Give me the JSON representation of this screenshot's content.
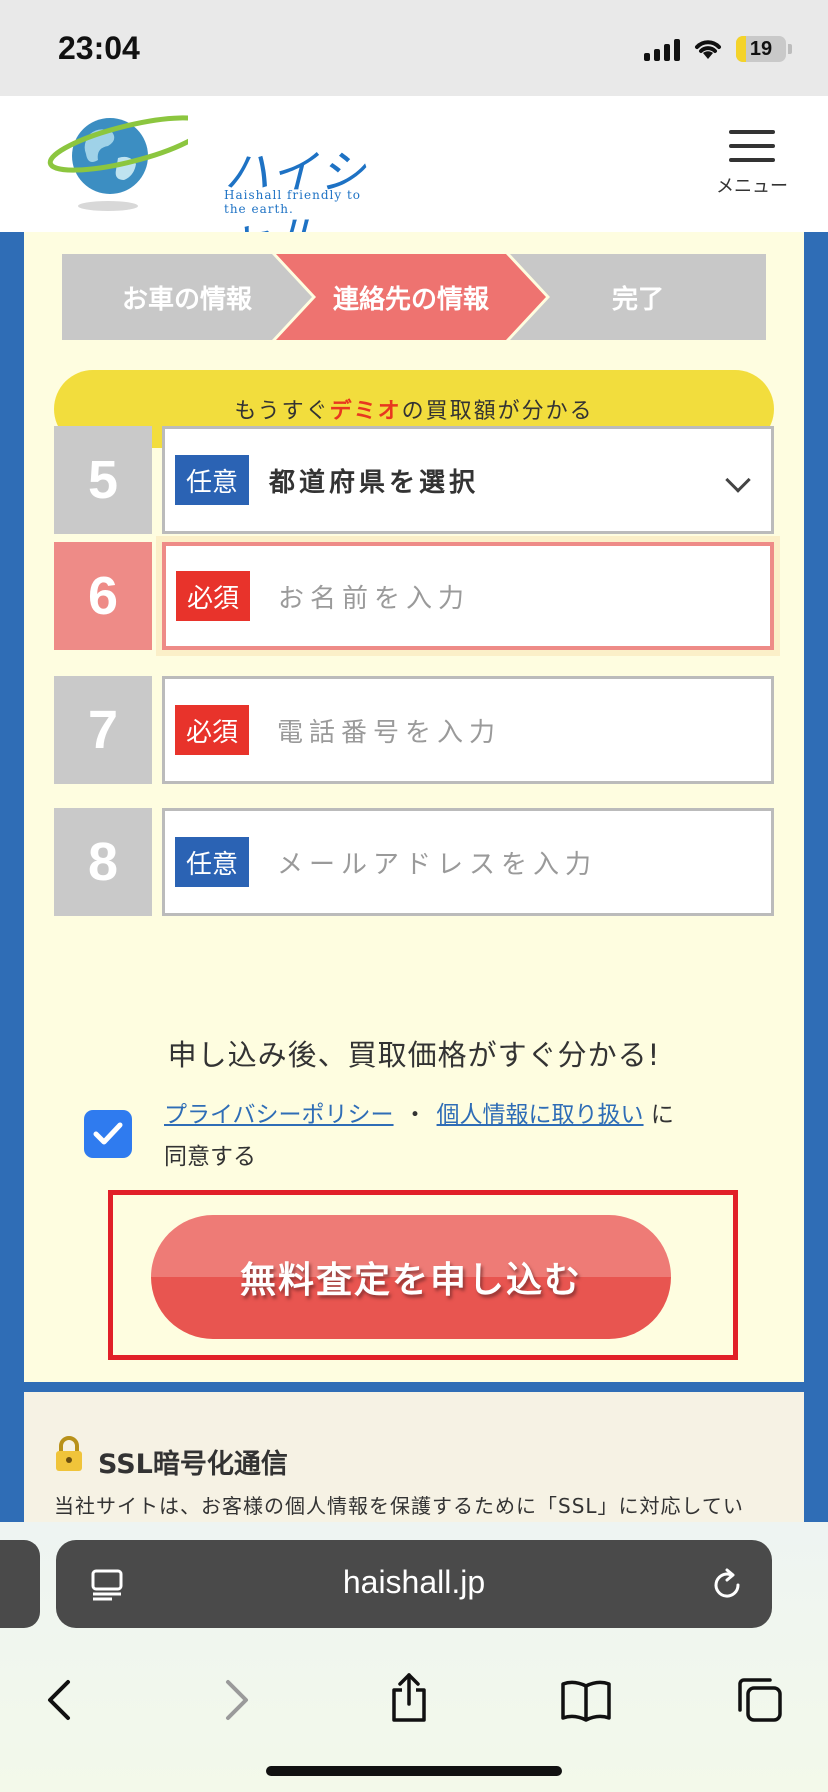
{
  "status_bar": {
    "time": "23:04",
    "battery": "19",
    "battery_level_percent": 19
  },
  "header": {
    "logo_text": "ハイシャル",
    "logo_tagline": "Haishall friendly to the earth.",
    "menu_label": "メニュー"
  },
  "steps": [
    {
      "label": "お車の情報",
      "state": "done"
    },
    {
      "label": "連絡先の情報",
      "state": "current"
    },
    {
      "label": "完了",
      "state": "todo"
    }
  ],
  "bubble": {
    "before": "もうすぐ",
    "highlight": "デミオ",
    "after": "の買取額が分かる"
  },
  "fields": [
    {
      "number": "5",
      "badge": "任意",
      "type": "select",
      "value": "都道府県を選択"
    },
    {
      "number": "6",
      "badge": "必須",
      "type": "text",
      "placeholder": "お名前を入力"
    },
    {
      "number": "7",
      "badge": "必須",
      "type": "tel",
      "placeholder": "電話番号を入力"
    },
    {
      "number": "8",
      "badge": "任意",
      "type": "email",
      "placeholder": "メールアドレスを入力"
    }
  ],
  "notice": "申し込み後、買取価格がすぐ分かる!",
  "agreement": {
    "checked": true,
    "privacy_link": "プライバシーポリシー",
    "separator": "・",
    "personal_info_link": "個人情報に取り扱い",
    "particle": "に",
    "suffix": "同意する"
  },
  "submit_label": "無料査定を申し込む",
  "ssl": {
    "title": "SSL暗号化通信",
    "description": "当社サイトは、お客様の個人情報を保護するために「SSL」に対応してい"
  },
  "browser": {
    "url": "haishall.jp"
  },
  "colors": {
    "accent_red": "#ee7370",
    "badge_blue": "#2b63b4",
    "badge_red": "#e8332b",
    "bubble_yellow": "#f2dd3d",
    "page_blue": "#2f6db6"
  }
}
